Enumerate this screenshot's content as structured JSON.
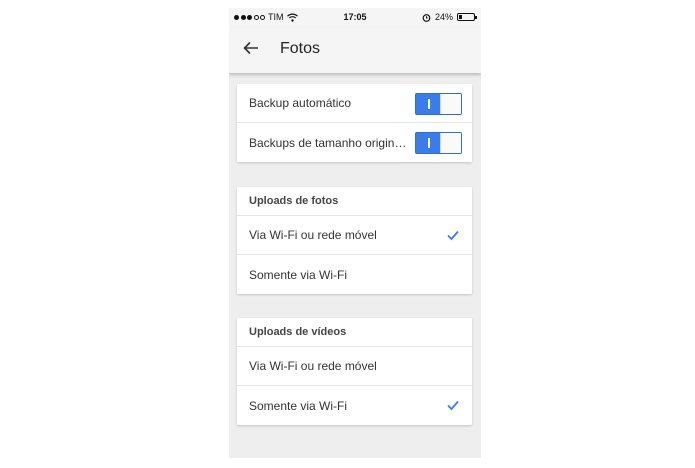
{
  "status_bar": {
    "carrier": "TIM",
    "time": "17:05",
    "battery": "24%",
    "battery_level": 0.24,
    "icons": [
      "signal-dots-icon",
      "wifi-icon",
      "alarm-icon",
      "battery-icon"
    ]
  },
  "app_bar": {
    "title": "Fotos",
    "back_icon": "arrow-left-icon"
  },
  "backup": {
    "items": [
      {
        "label": "Backup automático",
        "enabled": true
      },
      {
        "label": "Backups de tamanho originais",
        "enabled": true
      }
    ]
  },
  "photo_uploads": {
    "header": "Uploads de fotos",
    "options": [
      {
        "label": "Via Wi-Fi ou rede móvel",
        "selected": true
      },
      {
        "label": "Somente via Wi-Fi",
        "selected": false
      }
    ]
  },
  "video_uploads": {
    "header": "Uploads de vídeos",
    "options": [
      {
        "label": "Via Wi-Fi ou rede móvel",
        "selected": false
      },
      {
        "label": "Somente via Wi-Fi",
        "selected": true
      }
    ]
  },
  "colors": {
    "accent": "#3a7de8",
    "background": "#eeeeee",
    "app_bar": "#f5f5f5"
  }
}
